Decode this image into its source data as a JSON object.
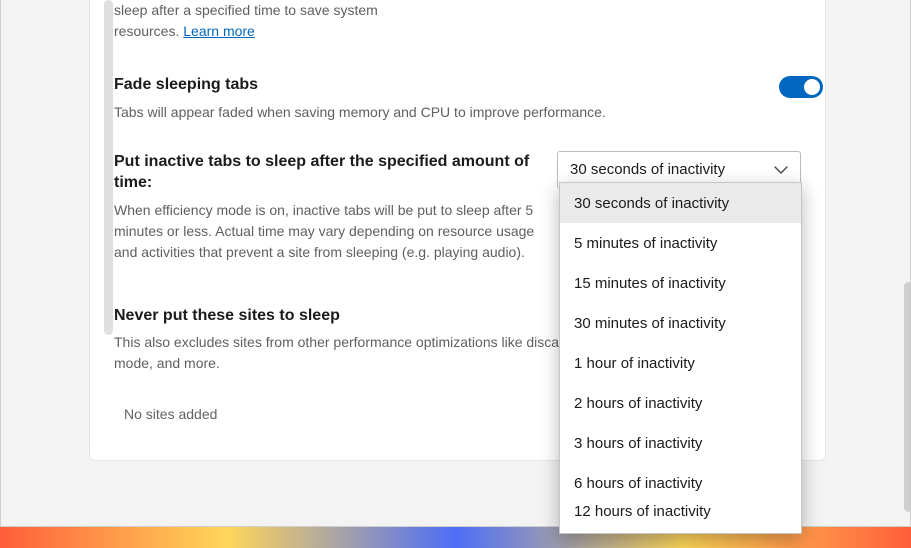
{
  "top_snippet": {
    "line": "sleep after a specified time to save system resources.",
    "learn_more": "Learn more"
  },
  "fade": {
    "title": "Fade sleeping tabs",
    "desc": "Tabs will appear faded when saving memory and CPU to improve performance.",
    "toggle_on": true
  },
  "sleep_after": {
    "title": "Put inactive tabs to sleep after the specified amount of time:",
    "desc": "When efficiency mode is on, inactive tabs will be put to sleep after 5 minutes or less. Actual time may vary depending on resource usage and activities that prevent a site from sleeping (e.g. playing audio).",
    "selected": "30 seconds of inactivity",
    "options": [
      "30 seconds of inactivity",
      "5 minutes of inactivity",
      "15 minutes of inactivity",
      "30 minutes of inactivity",
      "1 hour of inactivity",
      "2 hours of inactivity",
      "3 hours of inactivity",
      "6 hours of inactivity",
      "12 hours of inactivity"
    ]
  },
  "never_sleep": {
    "title": "Never put these sites to sleep",
    "desc": "This also excludes sites from other performance optimizations like discarding, efficiency mode, and more.",
    "empty": "No sites added"
  }
}
